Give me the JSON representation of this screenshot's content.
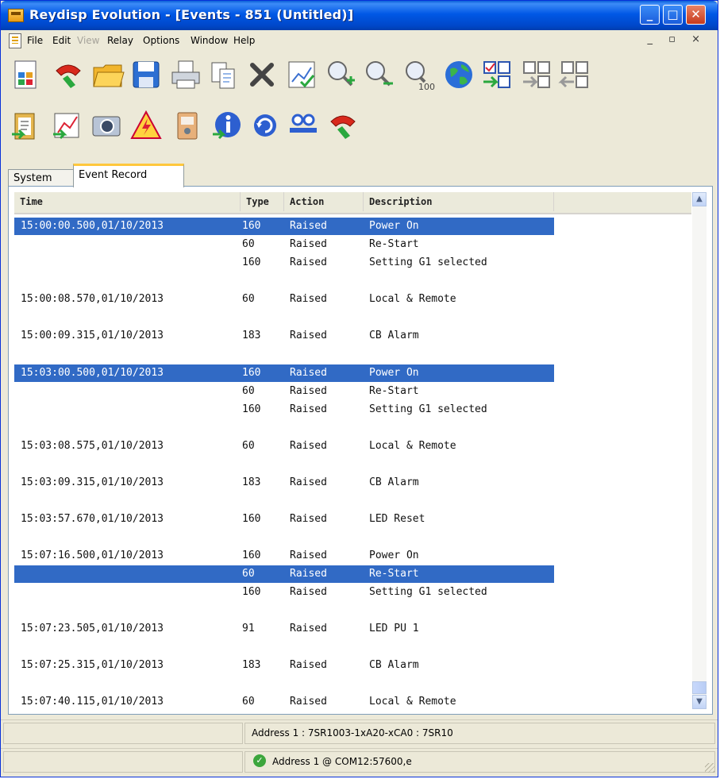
{
  "window": {
    "title": "Reydisp Evolution - [Events - 851 (Untitled)]",
    "controls": {
      "minimize": "_",
      "maximize": "□",
      "close": "✕"
    }
  },
  "menu": [
    {
      "label": "File",
      "enabled": true
    },
    {
      "label": "Edit",
      "enabled": true
    },
    {
      "label": "View",
      "enabled": false
    },
    {
      "label": "Relay",
      "enabled": true
    },
    {
      "label": "Options",
      "enabled": true
    },
    {
      "label": "Window",
      "enabled": true
    },
    {
      "label": "Help",
      "enabled": true
    }
  ],
  "mdi_controls": "_ ▫ ×",
  "toolbar": {
    "row1": [
      "relay-settings-icon",
      "disconnect-phone-icon",
      "open-folder-icon",
      "save-icon",
      "print-icon",
      "copy-icon",
      "delete-icon",
      "graph-check-icon",
      "zoom-in-icon",
      "zoom-out-icon",
      "zoom-100-icon",
      "globe-icon",
      "grid-check-icon",
      "grid-send-icon",
      "grid-receive-icon"
    ],
    "row2": [
      "clipboard-icon",
      "chart-icon",
      "camera-icon",
      "warning-icon",
      "meter-icon",
      "info-icon",
      "refresh-icon",
      "users-icon",
      "connect-phone-icon"
    ]
  },
  "tabs": [
    {
      "label": "System",
      "active": false
    },
    {
      "label": "Event Record",
      "active": true
    }
  ],
  "table": {
    "columns": [
      "Time",
      "Type",
      "Action",
      "Description"
    ],
    "rows": [
      {
        "time": "15:00:00.500,01/10/2013",
        "type": "160",
        "action": "Raised",
        "desc": "Power On",
        "selected": true
      },
      {
        "time": "",
        "type": "60",
        "action": "Raised",
        "desc": "Re-Start",
        "selected": false
      },
      {
        "time": "",
        "type": "160",
        "action": "Raised",
        "desc": "Setting G1 selected",
        "selected": false
      },
      {
        "time": "15:00:08.570,01/10/2013",
        "type": "60",
        "action": "Raised",
        "desc": "Local & Remote",
        "selected": false
      },
      {
        "time": "15:00:09.315,01/10/2013",
        "type": "183",
        "action": "Raised",
        "desc": "CB Alarm",
        "selected": false
      },
      {
        "time": "15:03:00.500,01/10/2013",
        "type": "160",
        "action": "Raised",
        "desc": "Power On",
        "selected": true
      },
      {
        "time": "",
        "type": "60",
        "action": "Raised",
        "desc": "Re-Start",
        "selected": false
      },
      {
        "time": "",
        "type": "160",
        "action": "Raised",
        "desc": "Setting G1 selected",
        "selected": false
      },
      {
        "time": "15:03:08.575,01/10/2013",
        "type": "60",
        "action": "Raised",
        "desc": "Local & Remote",
        "selected": false
      },
      {
        "time": "15:03:09.315,01/10/2013",
        "type": "183",
        "action": "Raised",
        "desc": "CB Alarm",
        "selected": false
      },
      {
        "time": "15:03:57.670,01/10/2013",
        "type": "160",
        "action": "Raised",
        "desc": "LED Reset",
        "selected": false
      },
      {
        "time": "15:07:16.500,01/10/2013",
        "type": "160",
        "action": "Raised",
        "desc": "Power On",
        "selected": false
      },
      {
        "time": "",
        "type": "60",
        "action": "Raised",
        "desc": "Re-Start",
        "selected": true
      },
      {
        "time": "",
        "type": "160",
        "action": "Raised",
        "desc": "Setting G1 selected",
        "selected": false
      },
      {
        "time": "15:07:23.505,01/10/2013",
        "type": "91",
        "action": "Raised",
        "desc": "LED PU 1",
        "selected": false
      },
      {
        "time": "15:07:25.315,01/10/2013",
        "type": "183",
        "action": "Raised",
        "desc": "CB Alarm",
        "selected": false
      },
      {
        "time": "15:07:40.115,01/10/2013",
        "type": "60",
        "action": "Raised",
        "desc": "Local & Remote",
        "selected": false
      }
    ]
  },
  "status": {
    "line1": "Address 1 : 7SR1003-1xA20-xCA0 : 7SR10",
    "line2": "Address 1  @ COM12:57600,e",
    "scroll_up": "▲",
    "scroll_down": "▼",
    "connected_check": "✓"
  }
}
